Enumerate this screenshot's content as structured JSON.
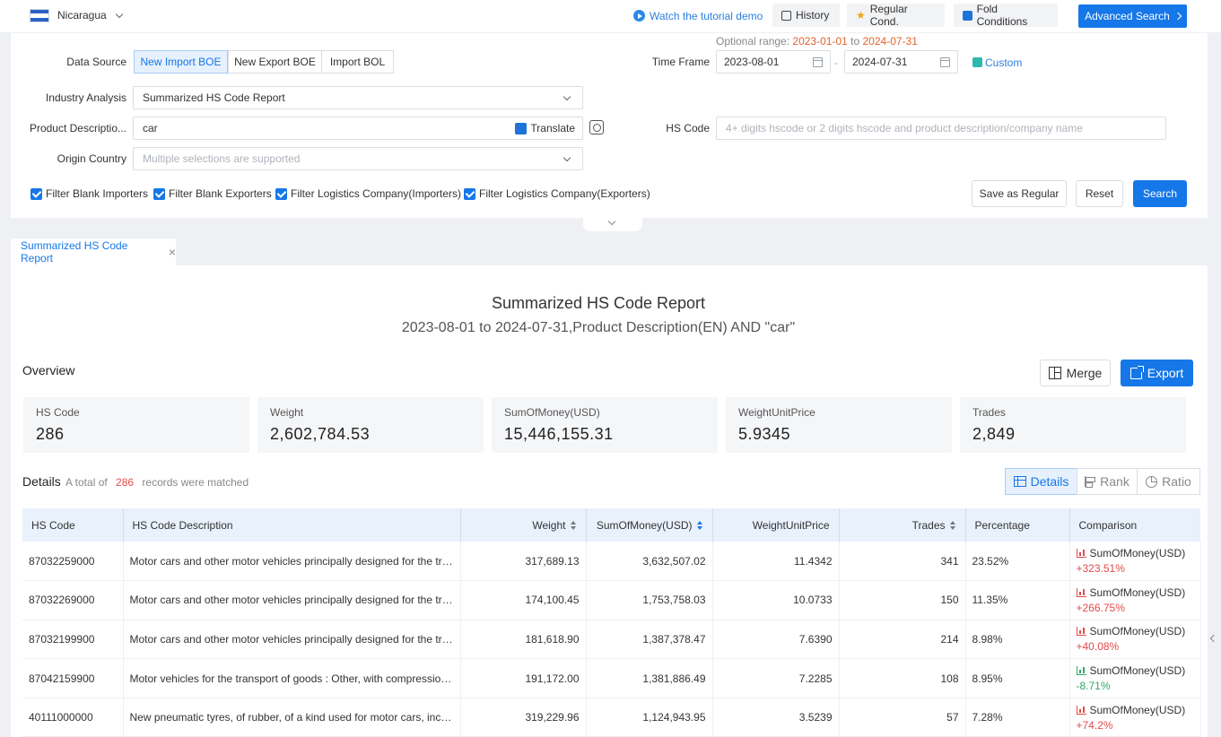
{
  "topbar": {
    "country": "Nicaragua",
    "tutorial": "Watch the tutorial demo",
    "history": "History",
    "regular_cond": "Regular Cond.",
    "fold": "Fold Conditions",
    "advanced": "Advanced Search"
  },
  "form": {
    "data_source_label": "Data Source",
    "data_sources": [
      "New Import BOE",
      "New Export BOE",
      "Import BOL"
    ],
    "industry_label": "Industry Analysis",
    "industry_value": "Summarized HS Code Report",
    "product_label": "Product Descriptio...",
    "product_value": "car",
    "translate": "Translate",
    "origin_label": "Origin Country",
    "origin_placeholder": "Multiple selections are supported",
    "optional_prefix": "Optional range:",
    "optional_start": "2023-01-01",
    "optional_to": "to",
    "optional_end": "2024-07-31",
    "timeframe_label": "Time Frame",
    "date_from": "2023-08-01",
    "date_sep": "-",
    "date_to": "2024-07-31",
    "custom": "Custom",
    "hs_label": "HS Code",
    "hs_placeholder": "4+ digits hscode or 2 digits hscode and product description/company name",
    "filters": [
      "Filter Blank Importers",
      "Filter Blank Exporters",
      "Filter Logistics Company(Importers)",
      "Filter Logistics Company(Exporters)"
    ],
    "save_regular": "Save as Regular",
    "reset": "Reset",
    "search": "Search"
  },
  "tab": {
    "label": "Summarized HS Code Report",
    "close": "×"
  },
  "report": {
    "title": "Summarized HS Code Report",
    "subtitle": "2023-08-01 to 2024-07-31,Product Description(EN) AND \"car\"",
    "overview_label": "Overview",
    "merge": "Merge",
    "export": "Export",
    "cards": [
      {
        "title": "HS Code",
        "value": "286"
      },
      {
        "title": "Weight",
        "value": "2,602,784.53"
      },
      {
        "title": "SumOfMoney(USD)",
        "value": "15,446,155.31"
      },
      {
        "title": "WeightUnitPrice",
        "value": "5.9345"
      },
      {
        "title": "Trades",
        "value": "2,849"
      }
    ],
    "details_label": "Details",
    "total_prefix": "A total of",
    "total_count": "286",
    "total_suffix": "records were matched",
    "view_tabs": [
      "Details",
      "Rank",
      "Ratio"
    ]
  },
  "table": {
    "headers": [
      "HS Code",
      "HS Code Description",
      "Weight",
      "SumOfMoney(USD)",
      "WeightUnitPrice",
      "Trades",
      "Percentage",
      "Comparison"
    ],
    "rows": [
      {
        "code": "87032259000",
        "desc": "Motor cars and other motor vehicles principally designed for the transport of persons",
        "weight": "317,689.13",
        "money": "3,632,507.02",
        "unit": "11.4342",
        "trades": "341",
        "pct": "23.52%",
        "cmp_label": "SumOfMoney(USD)",
        "cmp_value": "+323.51%",
        "dir": "up"
      },
      {
        "code": "87032269000",
        "desc": "Motor cars and other motor vehicles principally designed for the transport of persons",
        "weight": "174,100.45",
        "money": "1,753,758.03",
        "unit": "10.0733",
        "trades": "150",
        "pct": "11.35%",
        "cmp_label": "SumOfMoney(USD)",
        "cmp_value": "+266.75%",
        "dir": "up"
      },
      {
        "code": "87032199900",
        "desc": "Motor cars and other motor vehicles principally designed for the transport of persons",
        "weight": "181,618.90",
        "money": "1,387,378.47",
        "unit": "7.6390",
        "trades": "214",
        "pct": "8.98%",
        "cmp_label": "SumOfMoney(USD)",
        "cmp_value": "+40.08%",
        "dir": "up"
      },
      {
        "code": "87042159900",
        "desc": "Motor vehicles for the transport of goods : Other, with compression-ignition engine",
        "weight": "191,172.00",
        "money": "1,381,886.49",
        "unit": "7.2285",
        "trades": "108",
        "pct": "8.95%",
        "cmp_label": "SumOfMoney(USD)",
        "cmp_value": "-8.71%",
        "dir": "down"
      },
      {
        "code": "40111000000",
        "desc": "New pneumatic tyres, of rubber, of a kind used for motor cars, incl. station wagons",
        "weight": "319,229.96",
        "money": "1,124,943.95",
        "unit": "3.5239",
        "trades": "57",
        "pct": "7.28%",
        "cmp_label": "SumOfMoney(USD)",
        "cmp_value": "+74.2%",
        "dir": "up"
      }
    ]
  }
}
